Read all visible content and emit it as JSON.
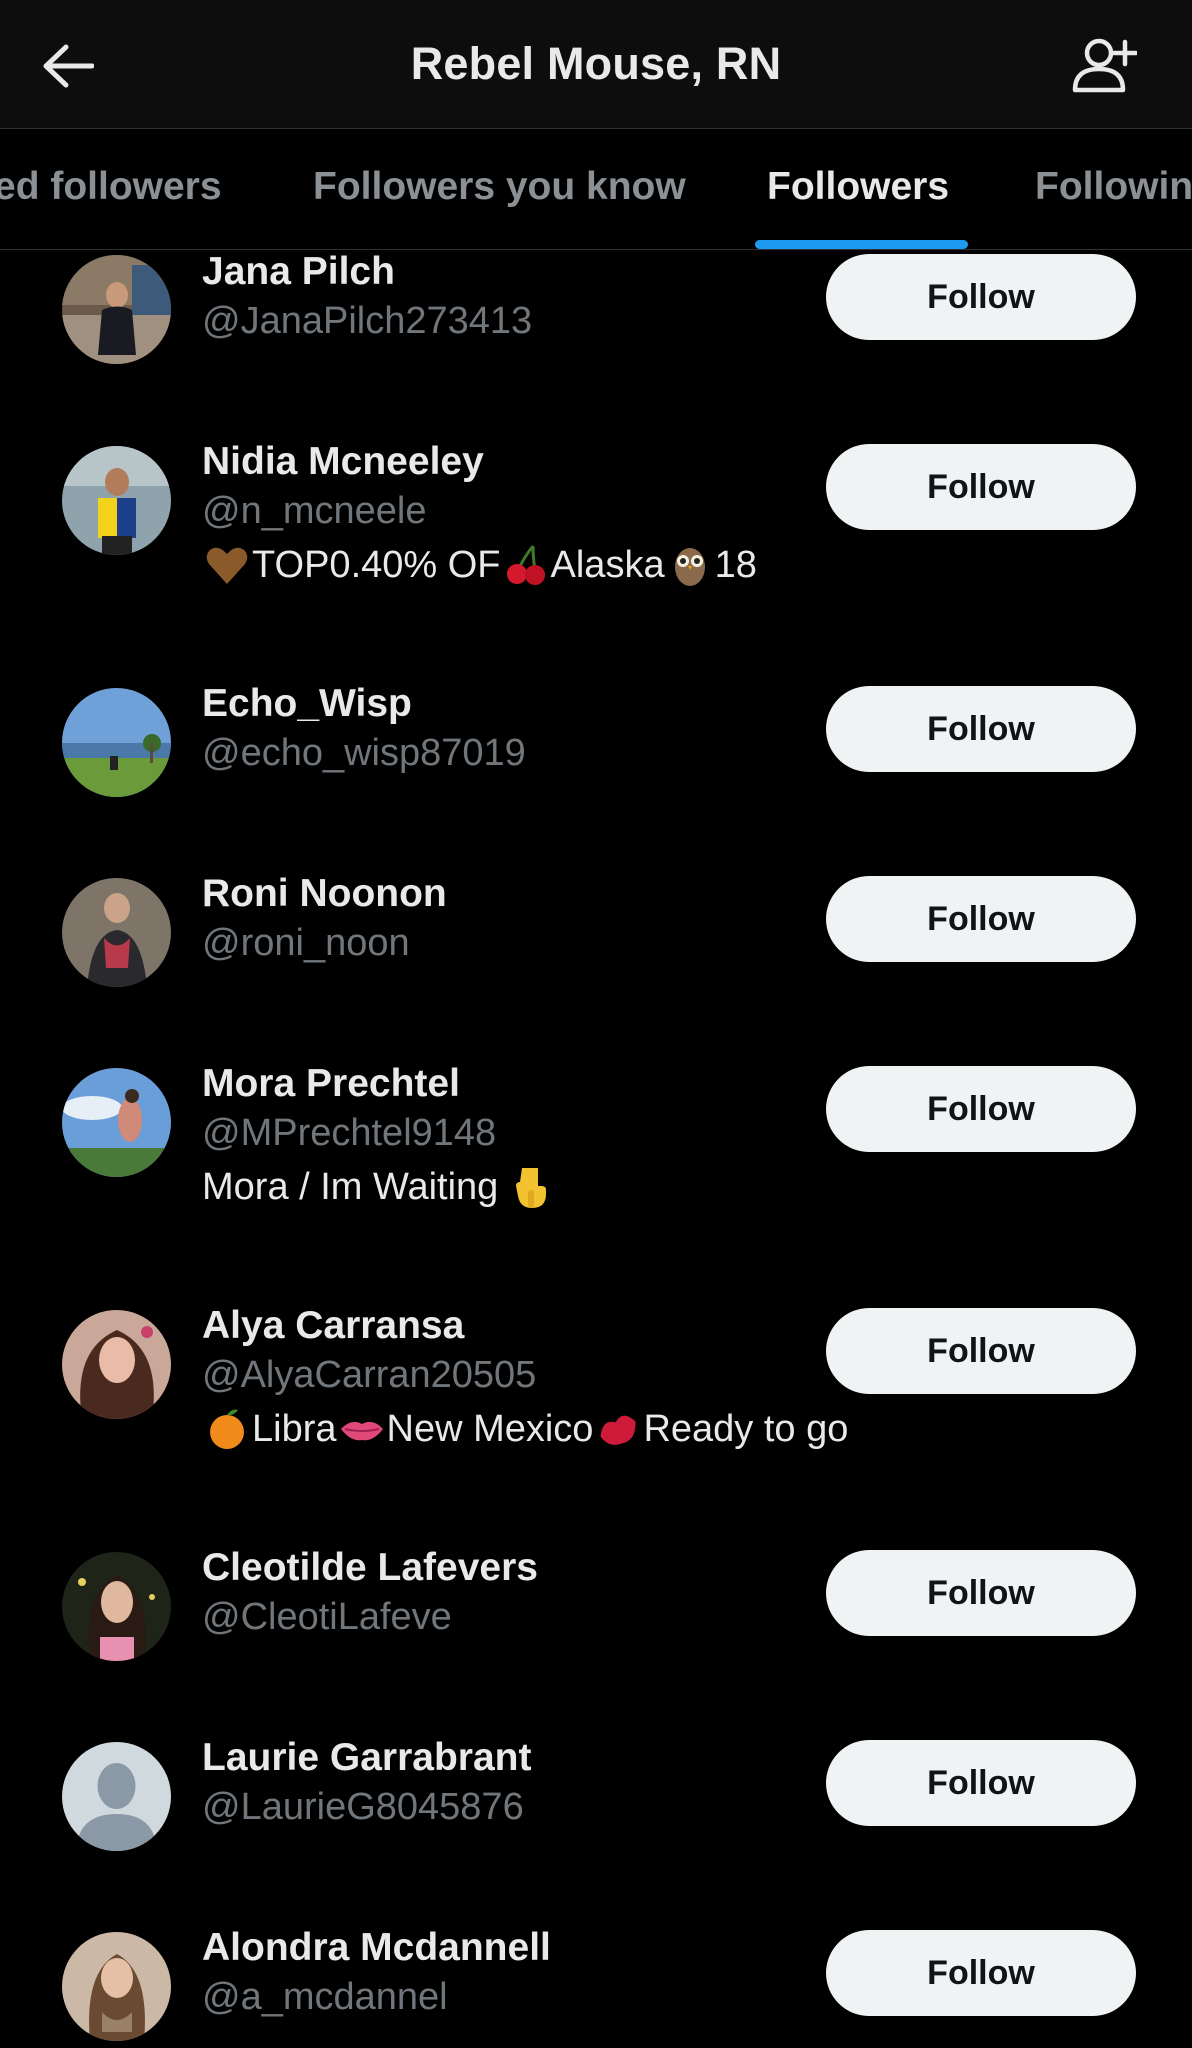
{
  "header": {
    "title": "Rebel Mouse, RN",
    "back_icon": "arrow-left-icon",
    "add_user_icon": "person-add-icon"
  },
  "tabs": [
    {
      "label": "ed followers",
      "active": false
    },
    {
      "label": "Followers you know",
      "active": false
    },
    {
      "label": "Followers",
      "active": true
    },
    {
      "label": "Followin",
      "active": false
    }
  ],
  "accent_color": "#1d9bf0",
  "follow_label": "Follow",
  "users": [
    {
      "name": "Jana Pilch",
      "handle": "@JanaPilch273413",
      "bio": null
    },
    {
      "name": "Nidia Mcneeley",
      "handle": "@n_mcneele",
      "bio": {
        "parts": [
          "TOP0.40% OF",
          "Alaska",
          "18"
        ],
        "icons": [
          "brown-heart-icon",
          "cherries-icon",
          "owl-icon"
        ]
      }
    },
    {
      "name": "Echo_Wisp",
      "handle": "@echo_wisp87019",
      "bio": null
    },
    {
      "name": "Roni Noonon",
      "handle": "@roni_noon",
      "bio": null
    },
    {
      "name": "Mora Prechtel",
      "handle": "@MPrechtel9148",
      "bio": {
        "parts": [
          "Mora / Im Waiting"
        ],
        "icons": [
          "pointing-down-icon"
        ]
      }
    },
    {
      "name": "Alya Carransa",
      "handle": "@AlyaCarran20505",
      "bio": {
        "parts": [
          "Libra",
          "New Mexico",
          "Ready to go"
        ],
        "icons": [
          "orange-icon",
          "lips-icon",
          "kiss-mark-icon"
        ]
      }
    },
    {
      "name": "Cleotilde Lafevers",
      "handle": "@CleotiLafeve",
      "bio": null
    },
    {
      "name": "Laurie Garrabrant",
      "handle": "@LaurieG8045876",
      "bio": null
    },
    {
      "name": "Alondra Mcdannell",
      "handle": "@a_mcdannel",
      "bio": null
    }
  ]
}
